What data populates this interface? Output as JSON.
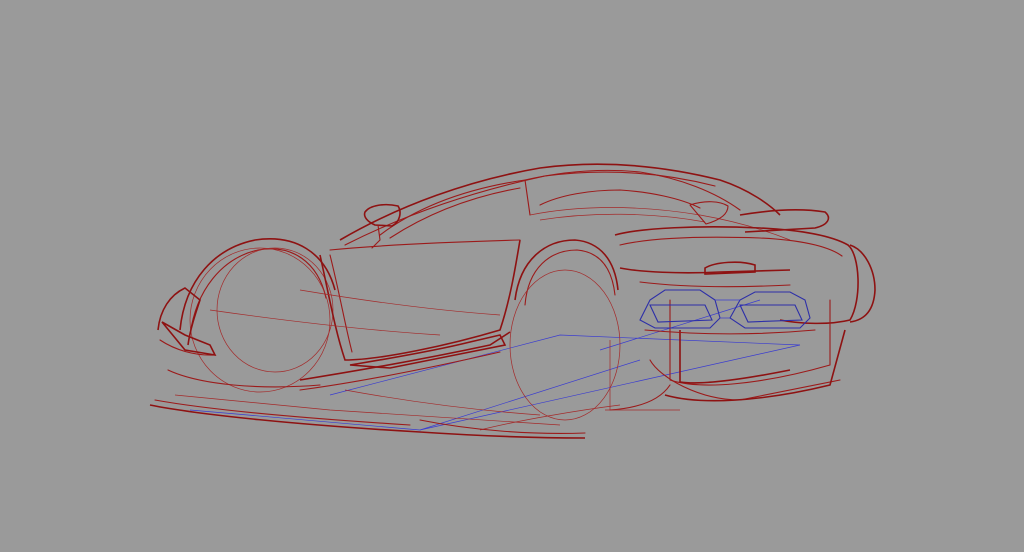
{
  "viewport": {
    "background_color": "#9a9a9a",
    "wire_color_primary": "#9c1a1a",
    "wire_color_secondary": "#2d2fa8",
    "subject": "sports-car-wireframe"
  }
}
